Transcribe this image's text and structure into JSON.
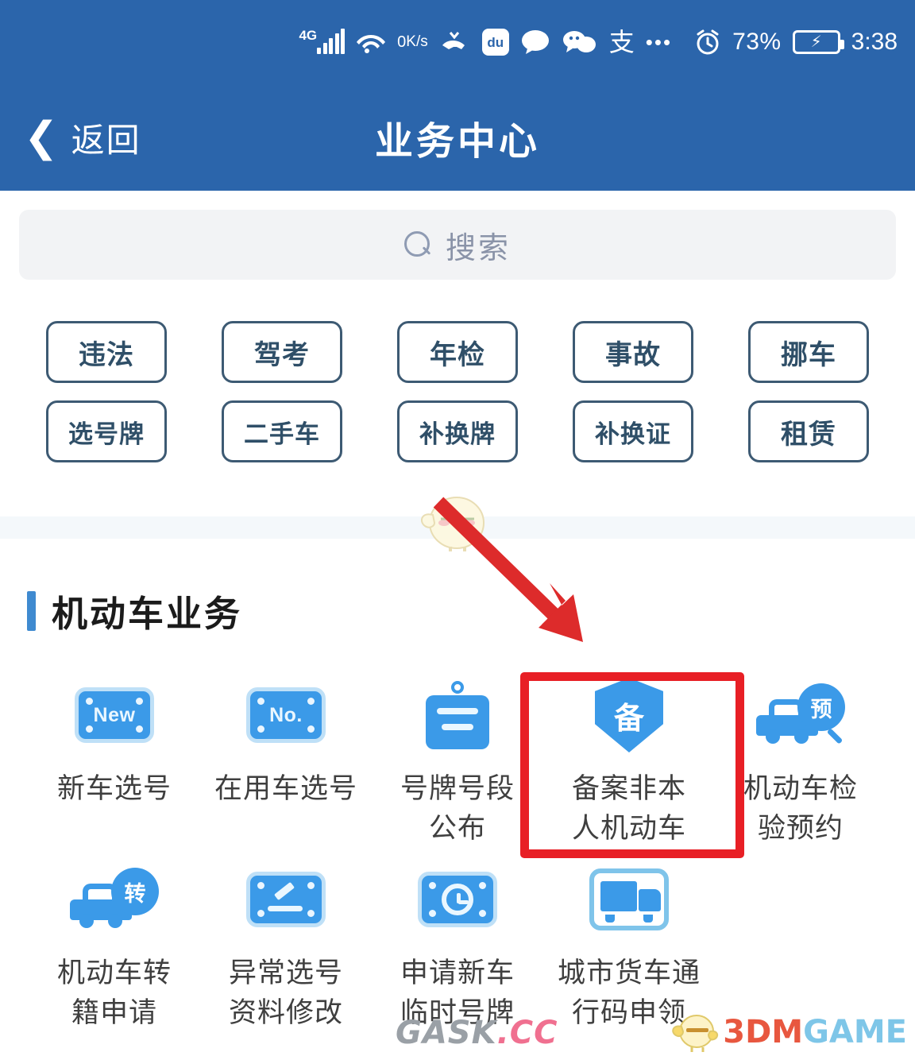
{
  "colors": {
    "header_blue": "#2b65ab",
    "chip_border": "#3d5a73",
    "icon_blue": "#3b9ae8",
    "accent_bar": "#3f8ad0",
    "highlight_red": "#e81f25",
    "arrow_red": "#dd2b2b"
  },
  "statusbar": {
    "network": "4G",
    "signal_icon": "signal-bars-icon",
    "wifi_icon": "wifi-icon",
    "speed_value": "0",
    "speed_unit": "K/s",
    "missed_call_icon": "missed-call-icon",
    "baidu_icon": "du",
    "message_icon": "message-bubble-icon",
    "wechat_icon": "wechat-icon",
    "alipay_icon": "支",
    "overflow_icon": "•••",
    "alarm_icon": "alarm-clock-icon",
    "battery_percent": "73%",
    "battery_charging_icon": "charging-bolt-icon",
    "time": "3:38"
  },
  "navbar": {
    "back_icon": "chevron-left-icon",
    "back_label": "返回",
    "title": "业务中心"
  },
  "search": {
    "icon": "search-icon",
    "placeholder": "搜索",
    "value": ""
  },
  "chips": {
    "row1": [
      {
        "label": "违法"
      },
      {
        "label": "驾考"
      },
      {
        "label": "年检"
      },
      {
        "label": "事故"
      },
      {
        "label": "挪车"
      }
    ],
    "row2": [
      {
        "label": "选号牌"
      },
      {
        "label": "二手车"
      },
      {
        "label": "补换牌"
      },
      {
        "label": "补换证"
      },
      {
        "label": "租赁"
      }
    ]
  },
  "section": {
    "title": "机动车业务"
  },
  "services": {
    "row1": [
      {
        "label": "新车选号",
        "icon": "license-plate-new-icon",
        "plate_text": "New"
      },
      {
        "label": "在用车选号",
        "icon": "license-plate-no-icon",
        "plate_text": "No."
      },
      {
        "label": "号牌号段\n公布",
        "icon": "hanging-sign-icon"
      },
      {
        "label": "备案非本\n人机动车",
        "icon": "shield-record-icon",
        "shield_text": "备",
        "highlighted": true
      },
      {
        "label": "机动车检\n验预约",
        "icon": "car-inspection-appointment-icon",
        "badge_text": "预"
      }
    ],
    "row2": [
      {
        "label": "机动车转\n籍申请",
        "icon": "car-transfer-icon",
        "badge_text": "转"
      },
      {
        "label": "异常选号\n资料修改",
        "icon": "plate-edit-icon"
      },
      {
        "label": "申请新车\n临时号牌",
        "icon": "plate-clock-icon"
      },
      {
        "label": "城市货车通\n行码申领",
        "icon": "city-truck-pass-icon"
      }
    ]
  },
  "annotations": {
    "arrow": "red-arrow-pointing-to-record-non-owner-vehicle",
    "highlight_target": "备案非本人机动车"
  },
  "watermarks": {
    "left_part1": "GASK",
    "left_part2": ".CC",
    "right_part1": "3DM",
    "right_part2": "GAME",
    "mascot_icon": "chick-mascot-icon"
  }
}
